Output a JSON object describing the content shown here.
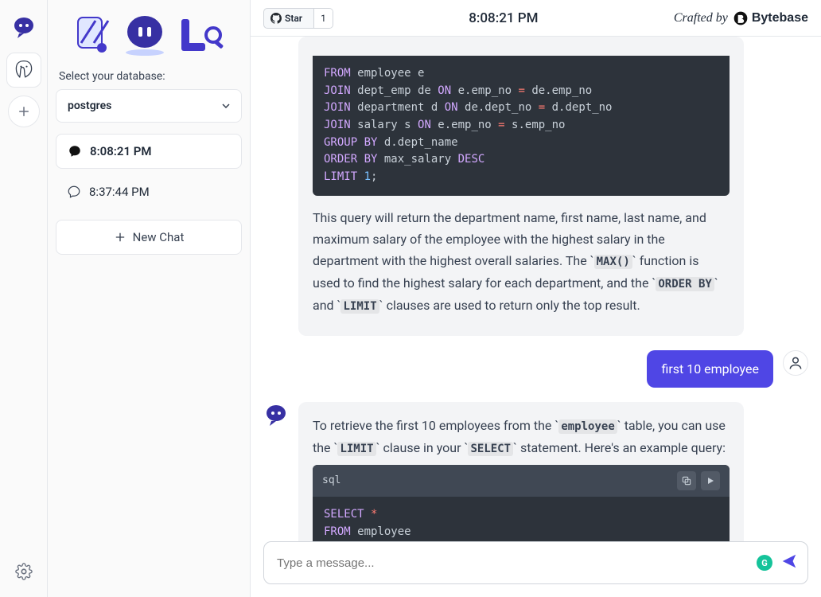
{
  "rail": {
    "add_tooltip": "Add connection",
    "settings_tooltip": "Settings"
  },
  "sidebar": {
    "db_label": "Select your database:",
    "db_selected": "postgres",
    "chats": [
      {
        "time": "8:08:21 PM",
        "selected": true
      },
      {
        "time": "8:37:44 PM",
        "selected": false
      }
    ],
    "new_chat_label": "New Chat"
  },
  "topbar": {
    "star_label": "Star",
    "star_count": "1",
    "time": "8:08:21 PM",
    "crafted_prefix": "Crafted by",
    "brand": "Bytebase"
  },
  "messages": {
    "m1": {
      "code_lines": [
        [
          {
            "t": "FROM",
            "c": "kw"
          },
          {
            "t": " employee e",
            "c": ""
          }
        ],
        [
          {
            "t": "JOIN",
            "c": "kw"
          },
          {
            "t": " dept_emp de ",
            "c": ""
          },
          {
            "t": "ON",
            "c": "kw"
          },
          {
            "t": " e.emp_no ",
            "c": ""
          },
          {
            "t": "=",
            "c": "op"
          },
          {
            "t": " de.emp_no",
            "c": ""
          }
        ],
        [
          {
            "t": "JOIN",
            "c": "kw"
          },
          {
            "t": " department d ",
            "c": ""
          },
          {
            "t": "ON",
            "c": "kw"
          },
          {
            "t": " de.dept_no ",
            "c": ""
          },
          {
            "t": "=",
            "c": "op"
          },
          {
            "t": " d.dept_no",
            "c": ""
          }
        ],
        [
          {
            "t": "JOIN",
            "c": "kw"
          },
          {
            "t": " salary s ",
            "c": ""
          },
          {
            "t": "ON",
            "c": "kw"
          },
          {
            "t": " e.emp_no ",
            "c": ""
          },
          {
            "t": "=",
            "c": "op"
          },
          {
            "t": " s.emp_no",
            "c": ""
          }
        ],
        [
          {
            "t": "GROUP BY",
            "c": "kw"
          },
          {
            "t": " d.dept_name",
            "c": ""
          }
        ],
        [
          {
            "t": "ORDER BY",
            "c": "kw"
          },
          {
            "t": " max_salary ",
            "c": ""
          },
          {
            "t": "DESC",
            "c": "kw"
          }
        ],
        [
          {
            "t": "LIMIT",
            "c": "kw"
          },
          {
            "t": " ",
            "c": ""
          },
          {
            "t": "1",
            "c": "num"
          },
          {
            "t": ";",
            "c": ""
          }
        ]
      ],
      "explain_1a": "This query will return the department name, first name, last name, and maximum salary of the employee with the highest salary in the department with the highest overall salaries. The ",
      "code_max": "MAX()",
      "explain_1b": " function is used to find the highest salary for each department, and the ",
      "code_orderby": "ORDER BY",
      "explain_1c": " and ",
      "code_limit": "LIMIT",
      "explain_1d": " clauses are used to return only the top result."
    },
    "m2": {
      "text": "first 10 employee"
    },
    "m3": {
      "p1a": "To retrieve the first 10 employees from the ",
      "code_employee": "employee",
      "p1b": " table, you can use the ",
      "code_limit": "LIMIT",
      "p1c": " clause in your ",
      "code_select": "SELECT",
      "p1d": " statement. Here's an example query:",
      "code_lang": "sql",
      "code_lines": [
        [
          {
            "t": "SELECT",
            "c": "kw"
          },
          {
            "t": " ",
            "c": ""
          },
          {
            "t": "*",
            "c": "op"
          }
        ],
        [
          {
            "t": "FROM",
            "c": "kw"
          },
          {
            "t": " employee",
            "c": ""
          }
        ]
      ]
    }
  },
  "composer": {
    "placeholder": "Type a message..."
  }
}
